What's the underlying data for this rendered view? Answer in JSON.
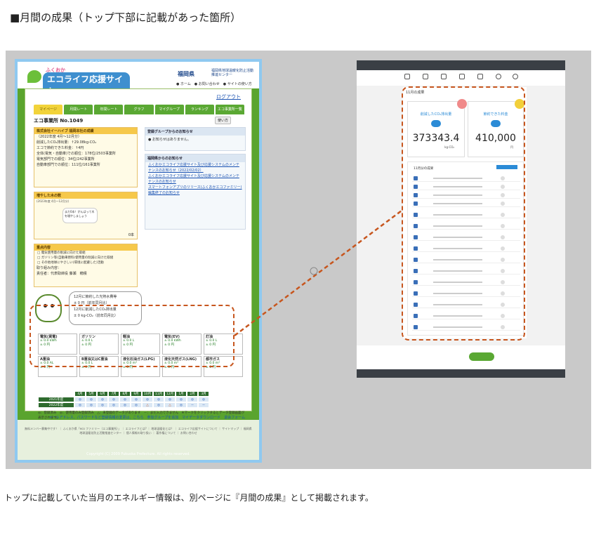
{
  "heading": "■月間の成果（トップ下部に記載があった箇所）",
  "caption": "トップに記載していた当月のエネルギー情報は、別ページに『月間の成果』として掲載されます。",
  "colors": {
    "highlight": "#c7561e",
    "panel_bg": "#c9c9c9",
    "old_site_green": "#5aa42e",
    "new_site_accent": "#2b8bd6"
  },
  "old_site": {
    "logo_small": "ふくおか",
    "logo_main": "エコライフ応援サイト",
    "pref_name": "福岡県",
    "pref_center": "福岡県地球温暖化防止活動推進センター",
    "head_links": "● ホーム　● お問い合わせ　● サイトの使い方",
    "logout": "ログアウト",
    "tabs": [
      "マイページ",
      "月間レート",
      "年間レート",
      "グラフ",
      "マイグループ",
      "ランキング",
      "エコ事業所一覧"
    ],
    "office_id": "エコ事業所 No.1049",
    "help": "使い方",
    "result_title": "株式会社イーハイブ 福岡本社の成績",
    "result_lines": [
      "（2022年度 4月～12月分）",
      "削減したCO₂排出量：↑29.08kg-CO₂",
      "エコで節約できた料金：↑4円",
      "全体(電気・自動車)での順位：178位/2503事業所",
      "電気部門での順位：34位/242事業所",
      "自動車部門での順位：111位/161事業所"
    ],
    "news1_title": "登録グループからのお知らせ",
    "news1_text": "● お知らせはありません。",
    "news2_title": "福岡県からのお知らせ",
    "news2_links": [
      "ふくおかエコライフ応援サイト及び応援システムのメンテナンスのお知らせ（2022/02/02）",
      "ふくおかエコライフ応援サイト及び応援システムのメンテナンスのお知らせ",
      "スマートフォンアプリのリリース(ふくおかエコファミリー)編集終了のお知らせ"
    ],
    "trees_title": "増やした木の数",
    "trees_sub": "(2023年度 4月～12月分)",
    "trees_bubble": "まだ0本！がんばって木を増やしましょう",
    "trees_count": "0本",
    "content_title": "重点内容",
    "content_items": [
      "電気使用量の削減に向けた取組",
      "ガソリン等(自動車燃料)使用量の削減に向けた取組",
      "その他地球にやさしい(環境に配慮した)活動"
    ],
    "effort_label": "取り組み内容：",
    "manager": "責任者：代表取締役 藤瀬　穂積",
    "month_lines": [
      "12月に節約した光熱水費等",
      "± 0 円（前年同月比）",
      "12月に削減したCO₂排出量",
      "± 0 kg-CO₂（前年同月比）"
    ],
    "energy_row1": [
      {
        "name": "電気(買電)",
        "v1": "± 0.0 kWh",
        "v2": "± 0 円"
      },
      {
        "name": "ガソリン",
        "v1": "± 0.0 L",
        "v2": "± 0 円"
      },
      {
        "name": "軽油",
        "v1": "± 0.0 L",
        "v2": "± 0 円"
      },
      {
        "name": "電気(EV)",
        "v1": "± 0.0 kWh",
        "v2": "± 0 円"
      },
      {
        "name": "灯油",
        "v1": "± 0.0 L",
        "v2": "± 0 円"
      }
    ],
    "energy_row2": [
      {
        "name": "A重油",
        "v1": "± 0.0 AL",
        "v2": "± 0 円"
      },
      {
        "name": "B重油又はC重油",
        "v1": "± 0.0 L",
        "v2": "± 0 円"
      },
      {
        "name": "液化石油ガス(LPG)",
        "v1": "± 0.0 m³",
        "v2": "± 0 円"
      },
      {
        "name": "液化天然ガス(LNG)",
        "v1": "± 0.0 m³",
        "v2": "± 0 円"
      },
      {
        "name": "都市ガス",
        "v1": "± 0.0 m³",
        "v2": "± 0 円"
      }
    ],
    "months": [
      "4月",
      "5月",
      "6月",
      "7月",
      "8月",
      "9月",
      "10月",
      "11月",
      "12月",
      "1月",
      "2月",
      "3月"
    ],
    "years": [
      {
        "label": "2021年度",
        "marks": [
          "◎",
          "◎",
          "◎",
          "◎",
          "◎",
          "◎",
          "◎",
          "◎",
          "◎",
          "◎",
          "◎",
          "◎"
        ]
      },
      {
        "label": "2022年度",
        "marks": [
          "◎",
          "◎",
          "◎",
          "◎",
          "◎",
          "◎",
          "△",
          "◎",
          "△",
          "◎",
          "－",
          "－"
        ]
      }
    ],
    "legend": "◎：登録済み　◎：使用量のみ登録済み　△：未登録のデータがあります　－：まだ入力できません　※マークをクリックするとデータ登録画面が表示されます。",
    "foot_links": "メールアドレス、パスワードなど登録情報の変更は、こちら　参加グループを追加　マイデータダウンロード　退会フォーム",
    "footer_text": "無料メンバー募集中です！ ｜ ふくおか県「eco ファミリー（エコ事業所）」 ｜ エコライフとは? ｜ 地球温暖化とは？ ｜ エコライフ応援サイトについて ｜ サイトマップ ｜ 福岡県地球温暖化防止活動推進センター ｜ 個人情報の取り扱い ｜ 著作権について ｜ お問い合わせ",
    "copyright": "Copyright (C) 2009 Fukuoka Prefecture. All rights reserved."
  },
  "new_site": {
    "main_title": "11月の成果",
    "card1_label": "削減したCO₂排出量",
    "card1_value": "373343.4",
    "card1_unit": "kg-CO₂",
    "card2_label": "節約できた料金",
    "card2_value": "410,000",
    "card2_unit": "円",
    "list_title": "11月分の成果"
  }
}
